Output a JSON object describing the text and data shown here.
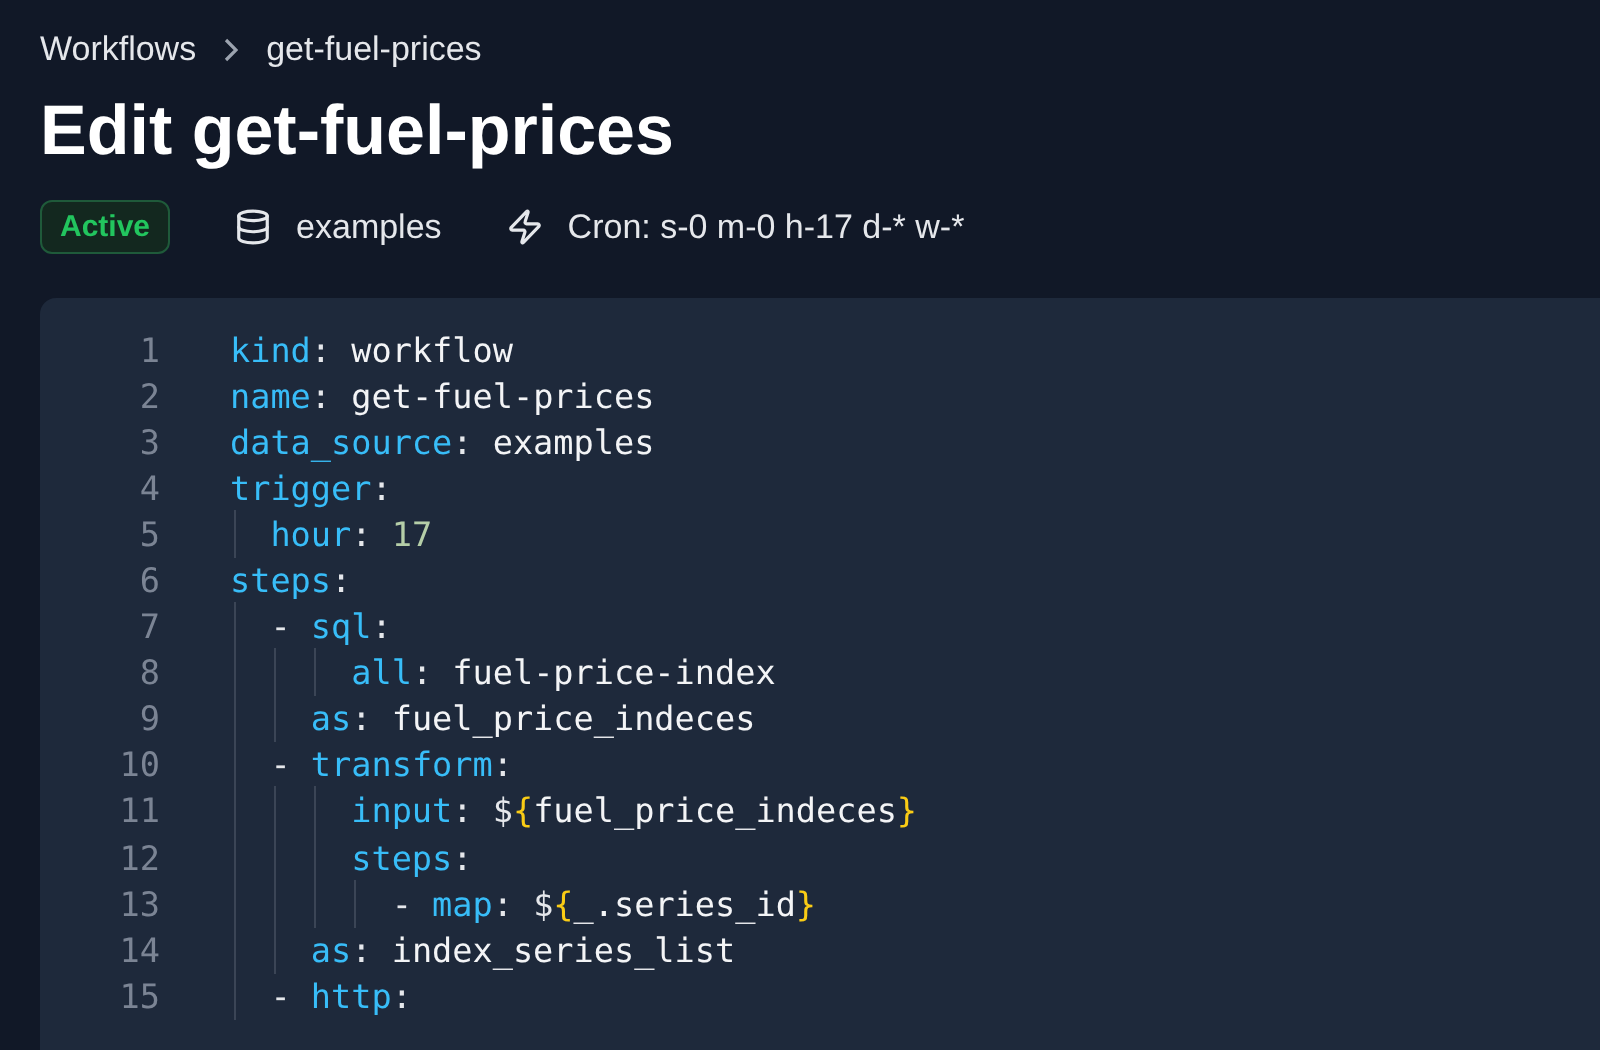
{
  "breadcrumb": [
    {
      "label": "Workflows"
    },
    {
      "label": "get-fuel-prices"
    }
  ],
  "title": "Edit get-fuel-prices",
  "status": {
    "label": "Active",
    "kind": "active"
  },
  "meta": [
    {
      "kind": "database",
      "label": "examples"
    },
    {
      "kind": "trigger",
      "label": "Cron: s-0 m-0 h-17 d-* w-*"
    }
  ],
  "editor": {
    "lines": [
      {
        "number": "1",
        "tokens": [
          {
            "kind": "key",
            "text": "kind"
          },
          {
            "kind": "punct",
            "text": ":"
          },
          {
            "kind": "value",
            "text": " workflow"
          }
        ]
      },
      {
        "number": "2",
        "tokens": [
          {
            "kind": "key",
            "text": "name"
          },
          {
            "kind": "punct",
            "text": ":"
          },
          {
            "kind": "value",
            "text": " get-fuel-prices"
          }
        ]
      },
      {
        "number": "3",
        "tokens": [
          {
            "kind": "key",
            "text": "data_source"
          },
          {
            "kind": "punct",
            "text": ":"
          },
          {
            "kind": "value",
            "text": " examples"
          }
        ]
      },
      {
        "number": "4",
        "tokens": [
          {
            "kind": "key",
            "text": "trigger"
          },
          {
            "kind": "punct",
            "text": ":"
          }
        ]
      },
      {
        "number": "5",
        "tokens": [
          {
            "kind": "key",
            "text": "  hour"
          },
          {
            "kind": "punct",
            "text": ":"
          },
          {
            "kind": "number",
            "text": " 17"
          }
        ]
      },
      {
        "number": "6",
        "tokens": [
          {
            "kind": "key",
            "text": "steps"
          },
          {
            "kind": "punct",
            "text": ":"
          }
        ]
      },
      {
        "number": "7",
        "tokens": [
          {
            "kind": "punct",
            "text": "  - "
          },
          {
            "kind": "key",
            "text": "sql"
          },
          {
            "kind": "punct",
            "text": ":"
          }
        ]
      },
      {
        "number": "8",
        "tokens": [
          {
            "kind": "key",
            "text": "      all"
          },
          {
            "kind": "punct",
            "text": ":"
          },
          {
            "kind": "value",
            "text": " fuel-price-index"
          }
        ]
      },
      {
        "number": "9",
        "tokens": [
          {
            "kind": "key",
            "text": "    as"
          },
          {
            "kind": "punct",
            "text": ":"
          },
          {
            "kind": "value",
            "text": " fuel_price_indeces"
          }
        ]
      },
      {
        "number": "10",
        "tokens": [
          {
            "kind": "punct",
            "text": "  - "
          },
          {
            "kind": "key",
            "text": "transform"
          },
          {
            "kind": "punct",
            "text": ":"
          }
        ]
      },
      {
        "number": "11",
        "tokens": [
          {
            "kind": "key",
            "text": "      input"
          },
          {
            "kind": "punct",
            "text": ": $"
          },
          {
            "kind": "brace",
            "text": "{"
          },
          {
            "kind": "value",
            "text": "fuel_price_indeces"
          },
          {
            "kind": "brace",
            "text": "}"
          }
        ]
      },
      {
        "number": "12",
        "tokens": [
          {
            "kind": "key",
            "text": "      steps"
          },
          {
            "kind": "punct",
            "text": ":"
          }
        ]
      },
      {
        "number": "13",
        "tokens": [
          {
            "kind": "punct",
            "text": "        - "
          },
          {
            "kind": "key",
            "text": "map"
          },
          {
            "kind": "punct",
            "text": ": $"
          },
          {
            "kind": "brace",
            "text": "{"
          },
          {
            "kind": "value",
            "text": "_.series_id"
          },
          {
            "kind": "brace",
            "text": "}"
          }
        ]
      },
      {
        "number": "14",
        "tokens": [
          {
            "kind": "key",
            "text": "    as"
          },
          {
            "kind": "punct",
            "text": ":"
          },
          {
            "kind": "value",
            "text": " index_series_list"
          }
        ]
      },
      {
        "number": "15",
        "tokens": [
          {
            "kind": "punct",
            "text": "  - "
          },
          {
            "kind": "key",
            "text": "http"
          },
          {
            "kind": "punct",
            "text": ":"
          }
        ]
      }
    ]
  }
}
